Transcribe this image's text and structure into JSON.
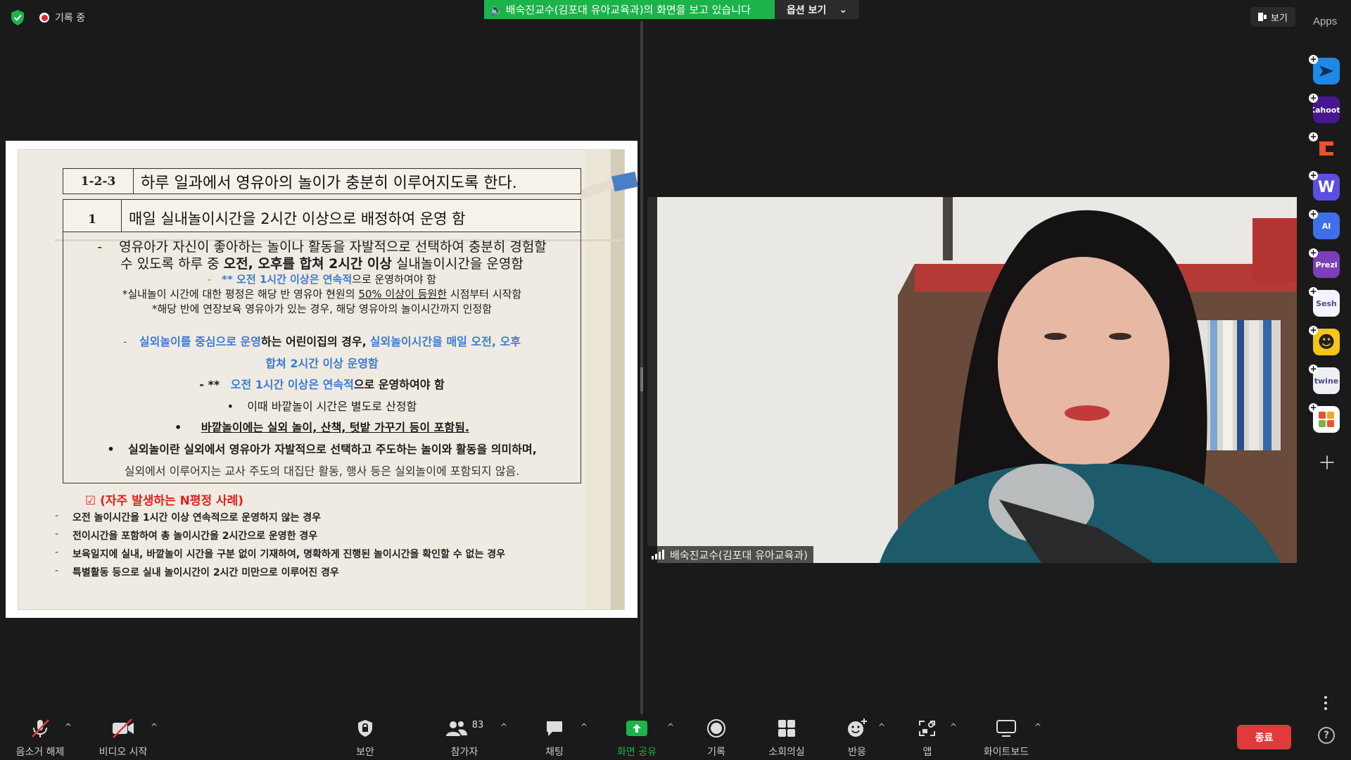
{
  "topbar": {
    "recording_label": "기록 중",
    "share_banner": "배숙진교수(김포대 유아교육과)의 화면을 보고 있습니다",
    "view_options": "옵션 보기",
    "view_button": "보기",
    "apps_label": "Apps"
  },
  "slide": {
    "h1_num": "1-2-3",
    "h1_text": "하루 일과에서 영유아의 놀이가 충분히 이루어지도록 한다.",
    "h2_num": "1",
    "h2_text": "매일 실내놀이시간을 2시간 이상으로 배정하여 운영 함",
    "l1_bullet": "-",
    "l1_a": "영유아가 자신이 좋아하는 놀이나 활동을 자발적으로 선택하여 충분히 경험할",
    "l1_b1": "수 있도록 하루 중",
    "l1_b2": "오전, 오후를 합쳐 2시간 이상",
    "l1_b3": "실내놀이시간을 운영함",
    "l2_prefix": "-",
    "l2_blue": "** 오전 1시간 이상은 연속적",
    "l2_rest": "으로 운영하여야 함",
    "l3_a": "*실내놀이 시간에 대한 평정은 해당 반 영유아 현원의",
    "l3_u": "50% 이상이 등원한",
    "l3_b": "시점부터 시작함",
    "l4": "*해당 반에 연장보육 영유아가 있는 경우, 해당 영유아의 놀이시간까지 인정함",
    "l5_dash": "-",
    "l5_blue1": "실외놀이를 중심으로 운영",
    "l5_mid": "하는 어린이집의 경우,",
    "l5_blue2": "실외놀이시간을 매일 오전, 오후",
    "l6": "합쳐 2시간 이상 운영함",
    "l7_prefix": "- **",
    "l7_blue": "오전 1시간 이상은 연속적",
    "l7_rest": "으로 운영하여야 함",
    "l8_bullet": "•",
    "l8": "이때 바깥놀이 시간은 별도로 산정함",
    "l9_bullet": "•",
    "l9": "바깥놀이에는 실외 놀이, 산책, 텃밭 가꾸기 등이 포함됨.",
    "l10_bullet": "•",
    "l10": "실외놀이란 실외에서 영유아가 자발적으로 선택하고 주도하는 놀이와 활동을 의미하며,",
    "l11": "실외에서 이루어지는 교사 주도의 대집단 활동, 행사 등은 실외놀이에 포함되지 않음.",
    "freq_title": "☑ (자주 발생하는 N평정 사례)",
    "freq_items": [
      "오전 놀이시간을 1시간 이상 연속적으로 운영하지 않는 경우",
      "전이시간을 포함하여 총 놀이시간을 2시간으로 운영한 경우",
      "보육일지에 실내, 바깥놀이 시간을 구분 없이 기재하여, 명확하게 진행된 놀이시간을 확인할 수 없는 경우",
      "특별활동 등으로 실내 놀이시간이 2시간 미만으로 이루어진 경우"
    ]
  },
  "video": {
    "participant_name": "배숙진교수(김포대 유아교육과)"
  },
  "apps": [
    {
      "name": "arrow",
      "label": "",
      "color": "#1e88e5"
    },
    {
      "name": "kahoot",
      "label": "Kahoot!",
      "color": "#46178f"
    },
    {
      "name": "cardboard",
      "label": "",
      "color": "#e8522e"
    },
    {
      "name": "wooclap",
      "label": "W",
      "color": "#5a4fe0"
    },
    {
      "name": "classpoint-ai",
      "label": "AI",
      "color": "#3f6fe8"
    },
    {
      "name": "prezi",
      "label": "Prezi",
      "color": "#7b3fb8"
    },
    {
      "name": "sesh",
      "label": "Sesh",
      "color": "#f4f4ff"
    },
    {
      "name": "emoji-app",
      "label": "☻",
      "color": "#f5c518"
    },
    {
      "name": "twine",
      "label": "twine",
      "color": "#eef0f6"
    },
    {
      "name": "tiles",
      "label": "",
      "color": "#ffffff"
    }
  ],
  "toolbar": {
    "mute": "음소거 해제",
    "video": "비디오 시작",
    "security": "보안",
    "participants": "참가자",
    "participants_count": "83",
    "chat": "채팅",
    "share": "화면 공유",
    "record": "기록",
    "breakout": "소회의실",
    "reactions": "반응",
    "apps": "앱",
    "whiteboard": "화이트보드",
    "end": "종료",
    "help": "?"
  },
  "colors": {
    "accent_green": "#1bb34a",
    "end_red": "#e03a3a",
    "slide_blue": "#3a7bd5",
    "slide_red": "#e02020"
  }
}
